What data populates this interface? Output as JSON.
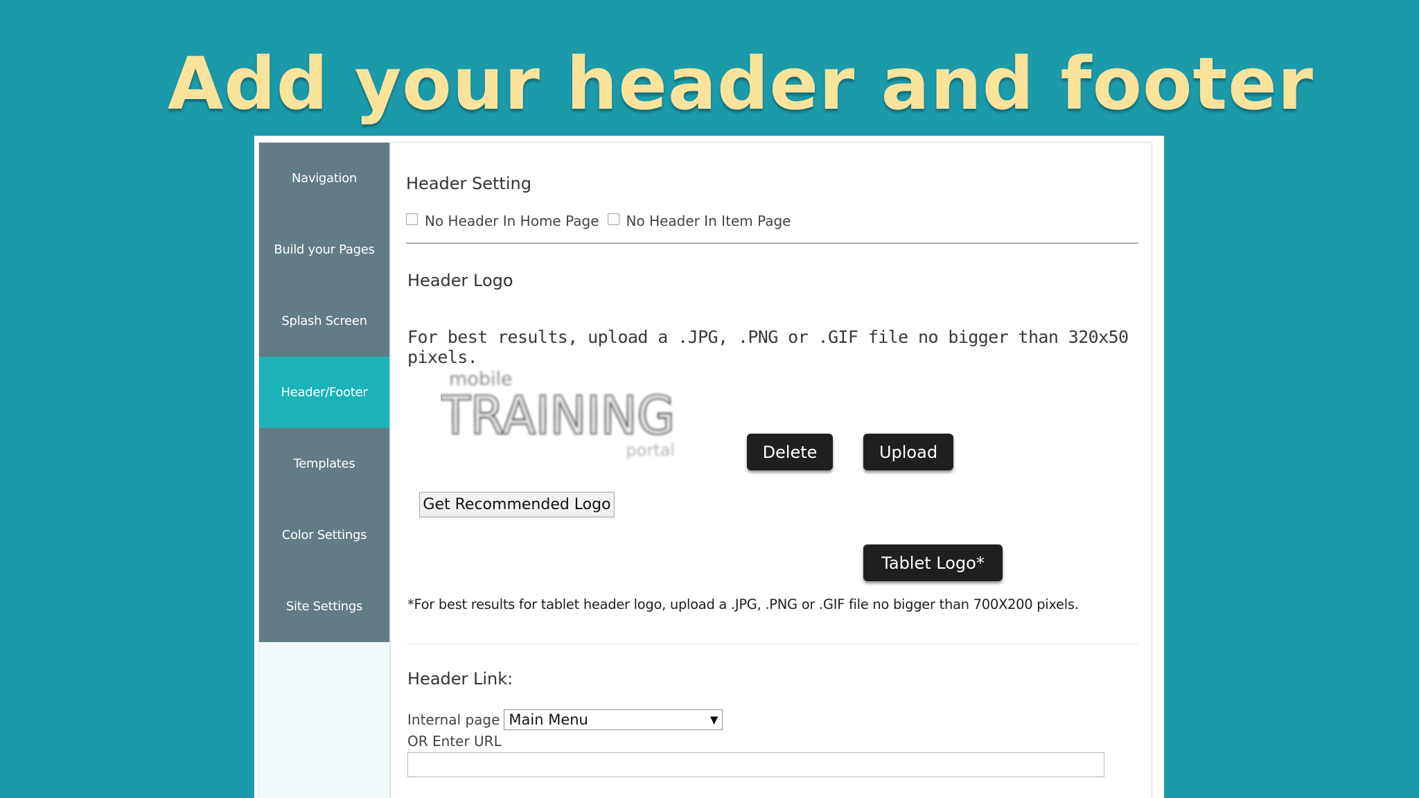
{
  "slide": {
    "title": "Add your header and footer"
  },
  "sidebar": {
    "items": [
      {
        "label": "Navigation",
        "active": false
      },
      {
        "label": "Build your Pages",
        "active": false
      },
      {
        "label": "Splash Screen",
        "active": false
      },
      {
        "label": "Header/Footer",
        "active": true
      },
      {
        "label": "Templates",
        "active": false
      },
      {
        "label": "Color Settings",
        "active": false
      },
      {
        "label": "Site Settings",
        "active": false
      }
    ]
  },
  "header_setting": {
    "title": "Header Setting",
    "checkboxes": [
      {
        "label": "No Header In Home Page",
        "checked": false
      },
      {
        "label": "No Header In Item Page",
        "checked": false
      }
    ]
  },
  "header_logo": {
    "title": "Header Logo",
    "hint": "For best results, upload a .JPG, .PNG or .GIF file no bigger than 320x50 pixels.",
    "logo": {
      "small_text": "mobile",
      "big_text": "TRAINING",
      "sub_text": "portal"
    },
    "delete_label": "Delete",
    "upload_label": "Upload",
    "recommended_label": "Get Recommended Logo",
    "tablet_label": "Tablet Logo*",
    "tablet_note": "*For best results for tablet header logo, upload a .JPG, .PNG or .GIF file no bigger than 700X200 pixels."
  },
  "header_link": {
    "title": "Header Link:",
    "internal_label": "Internal page",
    "internal_value": "Main Menu",
    "url_label": "OR Enter URL",
    "url_value": ""
  },
  "colors": {
    "background": "#1b9aaa",
    "title": "#fbe39b",
    "sidebar": "#617c84",
    "sidebar_active": "#1bb3b8",
    "button_dark": "#1f1f1f"
  }
}
